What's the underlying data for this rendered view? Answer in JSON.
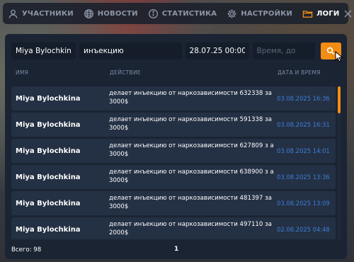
{
  "nav": {
    "items": [
      {
        "label": "УЧАСТНИКИ",
        "icon": "user-icon",
        "active": false
      },
      {
        "label": "НОВОСТИ",
        "icon": "globe-icon",
        "active": false
      },
      {
        "label": "СТАТИСТИКА",
        "icon": "info-icon",
        "active": false
      },
      {
        "label": "НАСТРОЙКИ",
        "icon": "gear-icon",
        "active": false
      },
      {
        "label": "ЛОГИ",
        "icon": "folder-icon",
        "active": true
      }
    ],
    "close_icon": "close-icon"
  },
  "filters": {
    "name_value": "Miya Bylochkina",
    "action_value": "инъекцию",
    "date_from_value": "28.07.25 00:00",
    "date_to_placeholder": "Время, до",
    "search_icon": "search-icon"
  },
  "table": {
    "headers": {
      "name": "ИМЯ",
      "action": "ДЕЙСТВИЕ",
      "date": "ДАТА И ВРЕМЯ"
    },
    "rows": [
      {
        "name": "Miya Bylochkina",
        "action": "делает инъекцию от наркозависимости 632338 за 3000$",
        "date": "03.08.2025 16:36"
      },
      {
        "name": "Miya Bylochkina",
        "action": "делает инъекцию от наркозависимости 591338 за 3000$",
        "date": "03.08.2025 16:31"
      },
      {
        "name": "Miya Bylochkina",
        "action": "делает инъекцию от наркозависимости 627809 з а 3000$",
        "date": "03.08.2025 14:01"
      },
      {
        "name": "Miya Bylochkina",
        "action": "делает инъекцию от наркозависимости 638900 з а 3000$",
        "date": "03.08.2025 13:36"
      },
      {
        "name": "Miya Bylochkina",
        "action": "делает инъекцию от наркозависимости 481397 за 3000$",
        "date": "03.08.2025 13:09"
      },
      {
        "name": "Miya Bylochkina",
        "action": "делает инъекцию от наркозависимости 497110 за 2000$",
        "date": "02.08.2025 04:48"
      }
    ]
  },
  "footer": {
    "total": "Всего: 98",
    "page": "1"
  },
  "colors": {
    "accent": "#f28c14",
    "panel": "#1b2433",
    "row": "#243044",
    "date": "#3d7fd6",
    "muted": "#7b8aa3"
  }
}
